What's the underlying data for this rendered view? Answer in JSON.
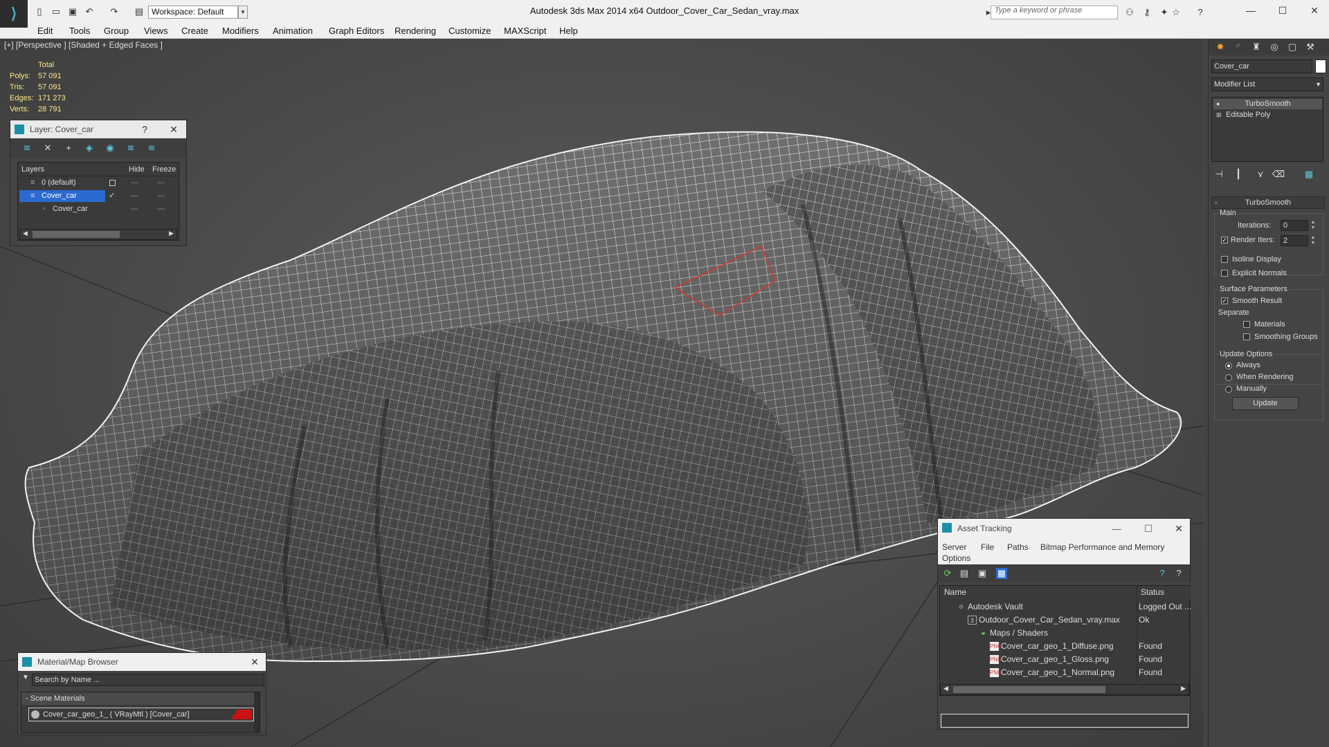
{
  "window": {
    "title": "Autodesk 3ds Max  2014 x64     Outdoor_Cover_Car_Sedan_vray.max",
    "workspace": "Workspace: Default",
    "search_placeholder": "Type a keyword or phrase"
  },
  "menu": [
    "Edit",
    "Tools",
    "Group",
    "Views",
    "Create",
    "Modifiers",
    "Animation",
    "Graph Editors",
    "Rendering",
    "Customize",
    "MAXScript",
    "Help"
  ],
  "viewport": {
    "label": "[+] [Perspective ] [Shaded + Edged Faces ]",
    "stats": {
      "header": "Total",
      "rows": [
        {
          "key": "Polys:",
          "value": "57 091"
        },
        {
          "key": "Tris:",
          "value": "57 091"
        },
        {
          "key": "Edges:",
          "value": "171 273"
        },
        {
          "key": "Verts:",
          "value": "28 791"
        }
      ]
    }
  },
  "layer_panel": {
    "title": "Layer: Cover_car",
    "help": "?",
    "close": "✕",
    "columns": {
      "layers": "Layers",
      "hide": "Hide",
      "freeze": "Freeze"
    },
    "rows": [
      {
        "name": "0 (default)"
      },
      {
        "name": "Cover_car"
      },
      {
        "name": "Cover_car"
      }
    ]
  },
  "command_panel": {
    "object_name": "Cover_car",
    "modifier_list": "Modifier List",
    "stack": [
      "TurboSmooth",
      "Editable Poly"
    ],
    "turbosmooth": {
      "title": "TurboSmooth",
      "main_label": "Main",
      "iterations_label": "Iterations:",
      "iterations_value": "0",
      "render_iters_label": "Render Iters:",
      "render_iters_value": "2",
      "isoline_display": "Isoline Display",
      "explicit_normals": "Explicit Normals",
      "surface_params": "Surface Parameters",
      "smooth_result": "Smooth Result",
      "separate": "Separate",
      "materials": "Materials",
      "smoothing_groups": "Smoothing Groups",
      "update_options": "Update Options",
      "always": "Always",
      "when_rendering": "When Rendering",
      "manually": "Manually",
      "update_button": "Update"
    }
  },
  "asset_tracking": {
    "title": "Asset Tracking",
    "menu": [
      "Server",
      "File",
      "Paths",
      "Bitmap Performance and Memory",
      "Options"
    ],
    "columns": {
      "name": "Name",
      "status": "Status"
    },
    "rows": [
      {
        "name": "Autodesk Vault",
        "status": "Logged Out ..."
      },
      {
        "name": "Outdoor_Cover_Car_Sedan_vray.max",
        "status": "Ok"
      },
      {
        "name": "Maps / Shaders",
        "status": ""
      },
      {
        "name": "Cover_car_geo_1_Diffuse.png",
        "status": "Found"
      },
      {
        "name": "Cover_car_geo_1_Gloss.png",
        "status": "Found"
      },
      {
        "name": "Cover_car_geo_1_Normal.png",
        "status": "Found"
      }
    ]
  },
  "material_browser": {
    "title": "Material/Map Browser",
    "search_placeholder": "Search by Name ...",
    "section": "Scene Materials",
    "item": "Cover_car_geo_1_ ( VRayMtl ) [Cover_car]"
  },
  "colors": {
    "accent": "#1b8fa8",
    "selection": "#2a6ad1",
    "stats_text": "#ffe88a",
    "material_swatch": "#cc1111"
  }
}
